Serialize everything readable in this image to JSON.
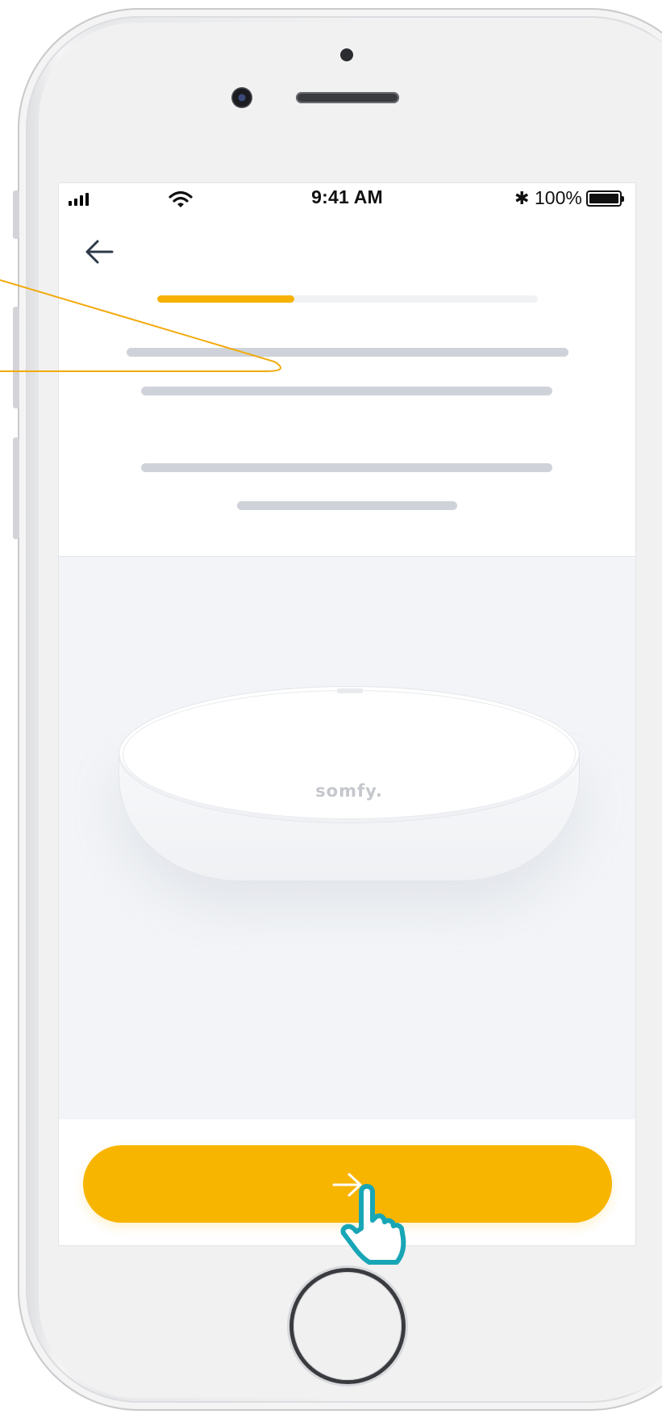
{
  "status_bar": {
    "time": "9:41 AM",
    "bluetooth_symbol": "✱",
    "battery_percent": "100%",
    "signal_icon": "cellular-signal-icon",
    "wifi_icon": "wifi-icon"
  },
  "header": {
    "back_icon": "back-arrow-icon"
  },
  "progress": {
    "value": 0.36
  },
  "device": {
    "brand_logo": "somfy."
  },
  "footer": {
    "next_icon": "arrow-right-icon"
  },
  "colors": {
    "accent": "#f8b500",
    "annotation_line": "#f2aa0c",
    "cursor": "#18a6b6",
    "skeleton": "#cfd3d9",
    "panel_bg": "#f2f4f7"
  }
}
